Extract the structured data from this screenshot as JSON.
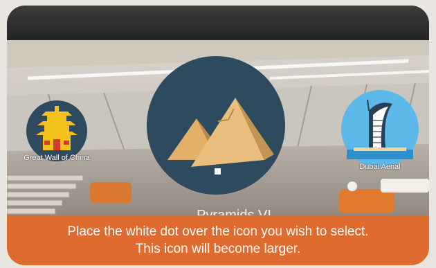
{
  "instruction": "Place the white dot over the icon you wish to select. This icon will become larger.",
  "destinations": [
    {
      "label": "Great Wall of China",
      "icon": "pagoda-icon",
      "selected": false
    },
    {
      "label": "Pyramids VI",
      "icon": "pyramids-icon",
      "selected": true
    },
    {
      "label": "Dubai Aerial",
      "icon": "burj-al-arab-icon",
      "selected": false
    }
  ],
  "colors": {
    "banner": "#df6b2e",
    "icon_circle": "#2e4a5e",
    "topbar": "#2f2f2f"
  }
}
